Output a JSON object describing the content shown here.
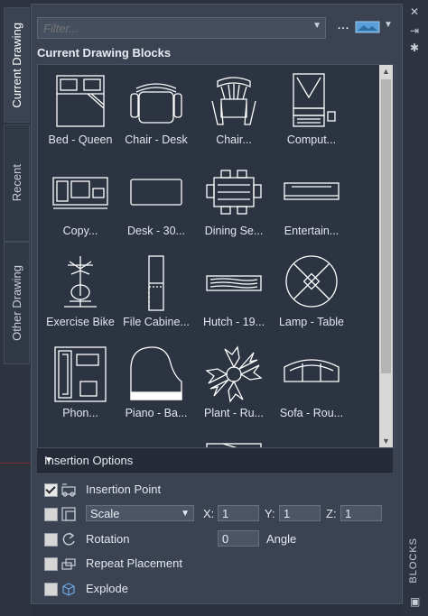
{
  "tabs": [
    "Current Drawing",
    "Recent",
    "Other Drawing"
  ],
  "filter": {
    "placeholder": "Filter..."
  },
  "toolbar": {
    "more": "...",
    "view_icon": "thumbnail-view-icon"
  },
  "section_title": "Current Drawing Blocks",
  "blocks": [
    {
      "label": "Bed - Queen",
      "icon": "bed-icon"
    },
    {
      "label": "Chair - Desk",
      "icon": "desk-chair-icon"
    },
    {
      "label": "Chair...",
      "icon": "chair-icon"
    },
    {
      "label": "Comput...",
      "icon": "computer-icon"
    },
    {
      "label": "Copy...",
      "icon": "copier-icon"
    },
    {
      "label": "Desk - 30...",
      "icon": "desk-icon"
    },
    {
      "label": "Dining Se...",
      "icon": "dining-set-icon"
    },
    {
      "label": "Entertain...",
      "icon": "entertainment-center-icon"
    },
    {
      "label": "Exercise Bike",
      "icon": "exercise-bike-icon"
    },
    {
      "label": "File Cabine...",
      "icon": "file-cabinet-icon"
    },
    {
      "label": "Hutch - 19...",
      "icon": "hutch-icon"
    },
    {
      "label": "Lamp - Table",
      "icon": "lamp-icon"
    },
    {
      "label": "Phon...",
      "icon": "phone-icon"
    },
    {
      "label": "Piano - Ba...",
      "icon": "piano-icon"
    },
    {
      "label": "Plant - Ru...",
      "icon": "plant-icon"
    },
    {
      "label": "Sofa - Rou...",
      "icon": "sofa-icon"
    }
  ],
  "insertion": {
    "header": "Insertion Options",
    "insertion_point": {
      "label": "Insertion Point",
      "checked": true
    },
    "scale": {
      "mode": "Scale",
      "x_label": "X:",
      "x": "1",
      "y_label": "Y:",
      "y": "1",
      "z_label": "Z:",
      "z": "1",
      "checked": false
    },
    "rotation": {
      "label": "Rotation",
      "value": "0",
      "unit": "Angle",
      "checked": false
    },
    "repeat": {
      "label": "Repeat Placement",
      "checked": false
    },
    "explode": {
      "label": "Explode",
      "checked": false
    }
  },
  "side_label": "BLOCKS"
}
